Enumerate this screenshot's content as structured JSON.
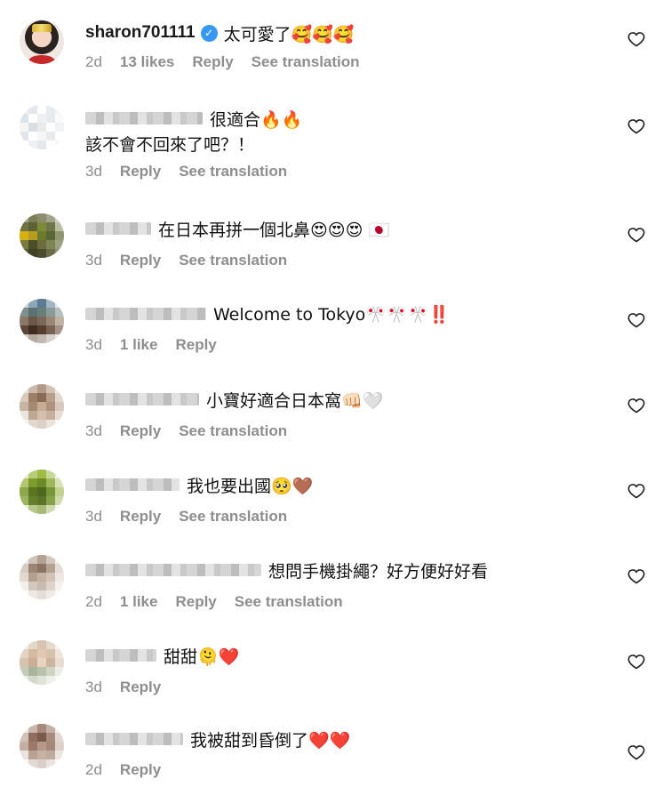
{
  "comments": [
    {
      "user": "sharon701111",
      "verified": true,
      "text": "太可愛了🥰🥰🥰",
      "text2": "",
      "date": "2d",
      "likes": "13 likes",
      "reply": "Reply",
      "translate": "See translation"
    },
    {
      "user": "",
      "text": "很適合🔥🔥",
      "text2": "該不會不回來了吧？！",
      "date": "3d",
      "likes": "",
      "reply": "Reply",
      "translate": "See translation"
    },
    {
      "user": "",
      "text": "在日本再拼一個北鼻😍😍😍 🇯🇵",
      "text2": "",
      "date": "3d",
      "likes": "",
      "reply": "Reply",
      "translate": "See translation"
    },
    {
      "user": "",
      "text": "Welcome to Tokyo🎌🎌🎌‼️",
      "text2": "",
      "date": "3d",
      "likes": "1 like",
      "reply": "Reply",
      "translate": ""
    },
    {
      "user": "",
      "text": "小寶好適合日本窩👊🏻🤍",
      "text2": "",
      "date": "3d",
      "likes": "",
      "reply": "Reply",
      "translate": "See translation"
    },
    {
      "user": "",
      "text": "我也要出國🥺🤎",
      "text2": "",
      "date": "3d",
      "likes": "",
      "reply": "Reply",
      "translate": "See translation"
    },
    {
      "user": "",
      "text": "想問手機掛繩？好方便好好看",
      "text2": "",
      "date": "2d",
      "likes": "1 like",
      "reply": "Reply",
      "translate": "See translation"
    },
    {
      "user": "",
      "text": "甜甜🫠❤️",
      "text2": "",
      "date": "3d",
      "likes": "",
      "reply": "Reply",
      "translate": ""
    },
    {
      "user": "",
      "text": "我被甜到昏倒了❤️❤️",
      "text2": "",
      "date": "2d",
      "likes": "",
      "reply": "Reply",
      "translate": ""
    }
  ],
  "icons": {
    "like": "heart-outline-icon",
    "verified": "verified-badge-icon"
  }
}
